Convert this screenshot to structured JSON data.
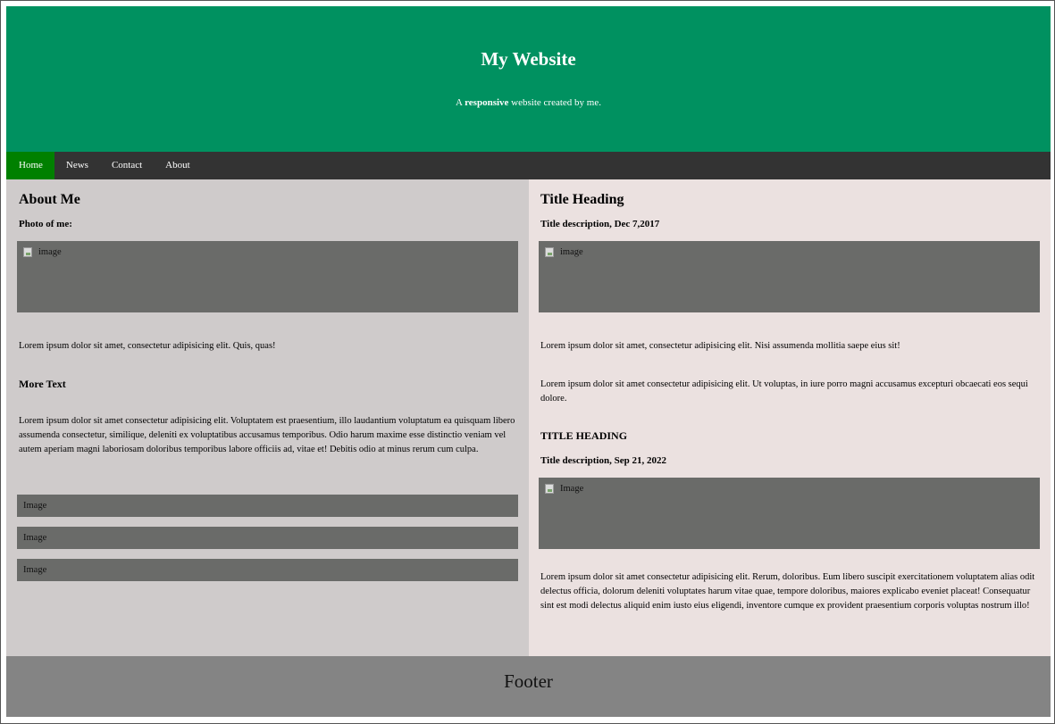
{
  "header": {
    "title": "My Website",
    "tagline_prefix": "A ",
    "tagline_bold": "responsive",
    "tagline_suffix": " website created by me."
  },
  "nav": {
    "items": [
      {
        "label": "Home",
        "active": true
      },
      {
        "label": "News",
        "active": false
      },
      {
        "label": "Contact",
        "active": false
      },
      {
        "label": "About",
        "active": false
      }
    ]
  },
  "left": {
    "heading": "About Me",
    "photo_label": "Photo of me:",
    "photo_alt": "image",
    "intro": "Lorem ipsum dolor sit amet, consectetur adipisicing elit. Quis, quas!",
    "more_heading": "More Text",
    "more_text": "Lorem ipsum dolor sit amet consectetur adipisicing elit. Voluptatem est praesentium, illo laudantium voluptatum ea quisquam libero assumenda consectetur, similique, deleniti ex voluptatibus accusamus temporibus. Odio harum maxime esse distinctio veniam vel autem aperiam magni laboriosam doloribus temporibus labore officiis ad, vitae et! Debitis odio at minus rerum cum culpa.",
    "images": [
      "Image",
      "Image",
      "Image"
    ]
  },
  "right": {
    "heading": "Title Heading",
    "desc1": "Title description, Dec 7,2017",
    "img1_alt": "image",
    "para1": "Lorem ipsum dolor sit amet, consectetur adipisicing elit. Nisi assumenda mollitia saepe eius sit!",
    "para2": "Lorem ipsum dolor sit amet consectetur adipisicing elit. Ut voluptas, in iure porro magni accusamus excepturi obcaecati eos sequi dolore.",
    "heading2": "TITLE HEADING",
    "desc2": "Title description, Sep 21, 2022",
    "img2_alt": "Image",
    "para3": "Lorem ipsum dolor sit amet consectetur adipisicing elit. Rerum, doloribus. Eum libero suscipit exercitationem voluptatem alias odit delectus officia, dolorum deleniti voluptates harum vitae quae, tempore doloribus, maiores explicabo eveniet placeat! Consequatur sint est modi delectus aliquid enim iusto eius eligendi, inventore cumque ex provident praesentium corporis voluptas nostrum illo!"
  },
  "footer": {
    "text": "Footer"
  },
  "colors": {
    "header_bg": "#009160",
    "nav_bg": "#333333",
    "nav_active": "#008000",
    "left_bg": "#cfcbcb",
    "right_bg": "#ebe1e0",
    "image_bg": "#6a6b69",
    "footer_bg": "#848484"
  }
}
